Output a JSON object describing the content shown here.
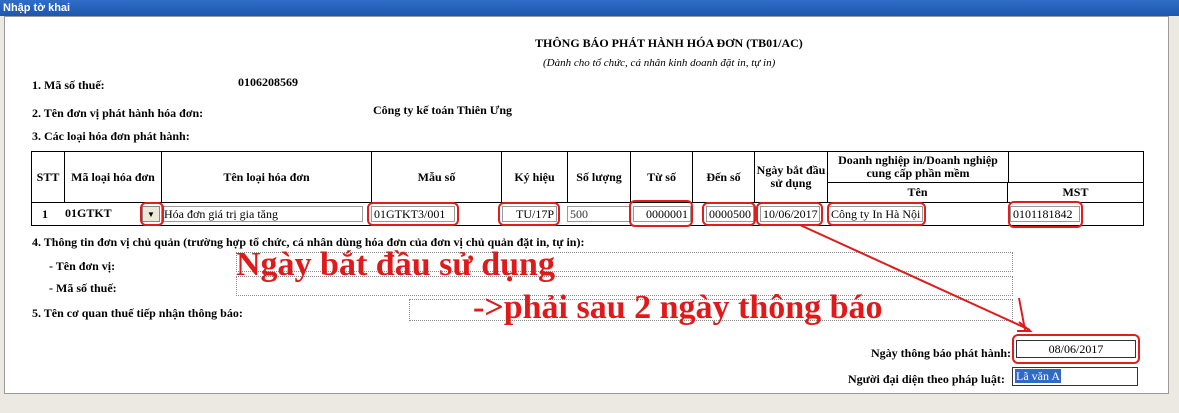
{
  "window": {
    "title": "Nhập tờ khai"
  },
  "form": {
    "title": "THÔNG BÁO PHÁT HÀNH HÓA ĐƠN (TB01/AC)",
    "subtitle": "(Dành cho tổ chức, cá nhân kinh doanh đặt in, tự in)",
    "tax_code_label": "1. Mã số thuế:",
    "tax_code_value": "0106208569",
    "issuer_label": "2. Tên đơn vị phát hành hóa đơn:",
    "issuer_value": "Công ty kế toán Thiên Ưng",
    "invoice_types_label": "3. Các loại hóa đơn phát hành:",
    "table": {
      "headers": {
        "stt": "STT",
        "type_code": "Mã loại hóa đơn",
        "type_name": "Tên loại hóa đơn",
        "template": "Mẫu số",
        "symbol": "Ký hiệu",
        "quantity": "Số lượng",
        "from_no": "Từ số",
        "to_no": "Đến số",
        "start_date": "Ngày bắt đầu sử dụng",
        "printer_group": "Doanh nghiệp in/Doanh nghiệp cung cấp phần mềm",
        "printer_name": "Tên",
        "printer_tax": "MST"
      },
      "rows": [
        {
          "stt": "1",
          "type_code": "01GTKT",
          "type_name": "Hóa đơn giá trị gia tăng",
          "template": "01GTKT3/001",
          "symbol": "TU/17P",
          "quantity": "500",
          "from_no": "0000001",
          "to_no": "0000500",
          "start_date": "10/06/2017",
          "printer_name": "Công ty In Hà Nội",
          "printer_tax": "0101181842"
        }
      ]
    },
    "parent_label": "4. Thông tin đơn vị chủ quản (trường hợp tổ chức, cá nhân dùng hóa đơn của đơn vị chủ quản đặt in, tự in):",
    "parent_name_label": "- Tên đơn vị:",
    "parent_tax_label": "- Mã số thuế:",
    "tax_office_label": "5. Tên cơ quan thuế tiếp nhận thông báo:",
    "notice_date_label": "Ngày thông báo phát hành:",
    "notice_date_value": "08/06/2017",
    "legal_rep_label": "Người đại diện theo pháp luật:",
    "legal_rep_value": "Lã văn A"
  },
  "annotation": {
    "line1": "Ngày bắt đầu sử dụng",
    "line2": "->phải sau 2 ngày thông báo",
    "color": "#e01a1a"
  }
}
